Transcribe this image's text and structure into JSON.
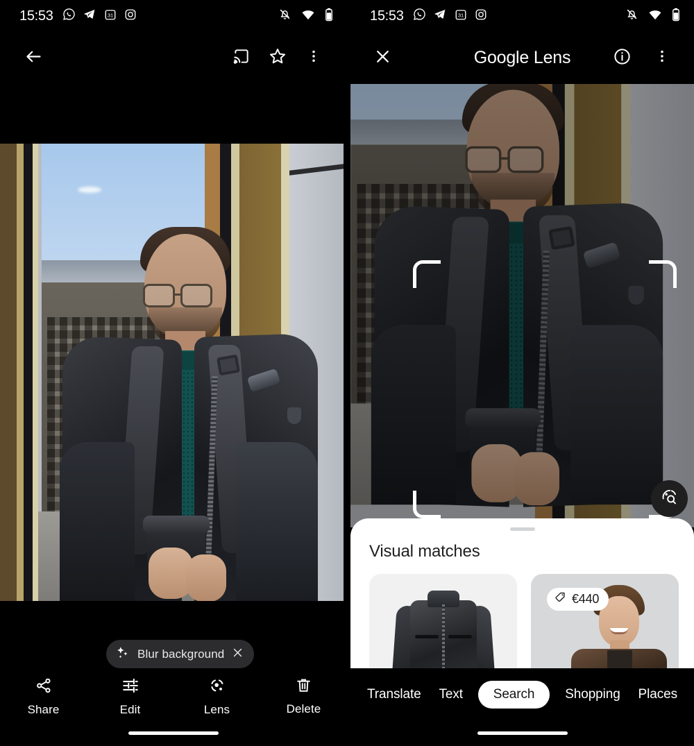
{
  "status_bar": {
    "time": "15:53",
    "left_icons": [
      "whatsapp-icon",
      "telegram-icon",
      "calendar-31-icon",
      "instagram-icon"
    ],
    "right_icons": [
      "notifications-off-icon",
      "wifi-icon",
      "battery-icon"
    ]
  },
  "photos_screen": {
    "toolbar": {
      "back": "back-arrow-icon",
      "cast": "cast-icon",
      "favorite": "star-outline-icon",
      "overflow": "more-vert-icon"
    },
    "blur_chip": {
      "sparkle_icon": "sparkle-icon",
      "label": "Blur background",
      "close_icon": "close-icon"
    },
    "actions": [
      {
        "icon": "share-icon",
        "label": "Share"
      },
      {
        "icon": "tune-icon",
        "label": "Edit"
      },
      {
        "icon": "lens-icon",
        "label": "Lens"
      },
      {
        "icon": "trash-icon",
        "label": "Delete"
      }
    ]
  },
  "lens_screen": {
    "header": {
      "close_icon": "close-icon",
      "title": "Google Lens",
      "info_icon": "info-circle-icon",
      "overflow": "more-vert-icon"
    },
    "selection": {
      "corner_brackets": 4,
      "fab_icon": "lens-search-icon"
    },
    "sheet": {
      "handle": "drag-handle",
      "title": "Visual matches",
      "cards": [
        {
          "name": "black-leather-jacket",
          "price": ""
        },
        {
          "name": "man-in-brown-leather-jacket",
          "price": "€440",
          "price_icon": "price-tag-icon"
        }
      ]
    },
    "tabs": [
      {
        "label": "Translate",
        "active": false
      },
      {
        "label": "Text",
        "active": false
      },
      {
        "label": "Search",
        "active": true
      },
      {
        "label": "Shopping",
        "active": false
      },
      {
        "label": "Places",
        "active": false
      }
    ]
  },
  "colors": {
    "background": "#000000",
    "chip_bg": "#2c2c2e",
    "sheet_bg": "#ffffff",
    "accent_white": "#ffffff",
    "card_a_bg": "#f1f1f1",
    "card_b_bg": "#d7d8da"
  }
}
